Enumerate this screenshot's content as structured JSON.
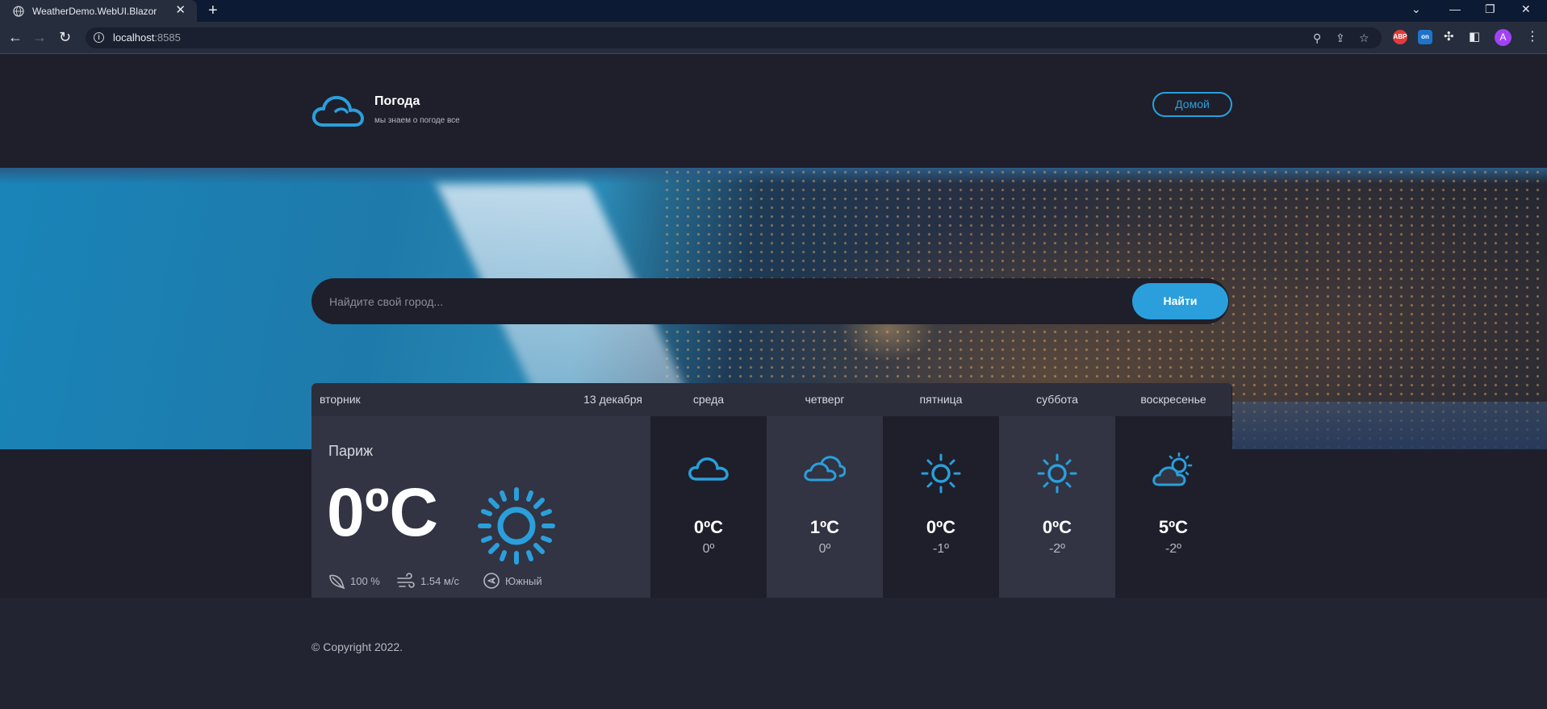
{
  "browser": {
    "tab_title": "WeatherDemo.WebUI.Blazor",
    "url_host": "localhost",
    "url_port": ":8585",
    "extensions": [
      "ABP",
      "on"
    ],
    "avatar_letter": "A"
  },
  "header": {
    "logo_title": "Погода",
    "logo_subtitle": "мы знаем о погоде все",
    "home_button": "Домой"
  },
  "search": {
    "placeholder": "Найдите свой город...",
    "button": "Найти"
  },
  "today": {
    "weekday": "вторник",
    "date": "13 декабря",
    "city": "Париж",
    "temperature": "0ºC",
    "icon": "sun-icon",
    "humidity": "100 %",
    "wind_speed": "1.54 м/с",
    "wind_direction": "Южный"
  },
  "forecast": [
    {
      "weekday": "среда",
      "temp": "0ºC",
      "temp_min": "0º",
      "icon": "cloud-icon"
    },
    {
      "weekday": "четверг",
      "temp": "1ºC",
      "temp_min": "0º",
      "icon": "clouds-icon"
    },
    {
      "weekday": "пятница",
      "temp": "0ºC",
      "temp_min": "-1º",
      "icon": "sun-icon"
    },
    {
      "weekday": "суббота",
      "temp": "0ºC",
      "temp_min": "-2º",
      "icon": "sun-icon"
    },
    {
      "weekday": "воскресенье",
      "temp": "5ºC",
      "temp_min": "-2º",
      "icon": "partly-cloudy-icon"
    }
  ],
  "footer": {
    "copyright": "© Copyright 2022."
  },
  "colors": {
    "accent": "#2a9fdc",
    "background": "#1e1f2a",
    "card": "#323443"
  }
}
